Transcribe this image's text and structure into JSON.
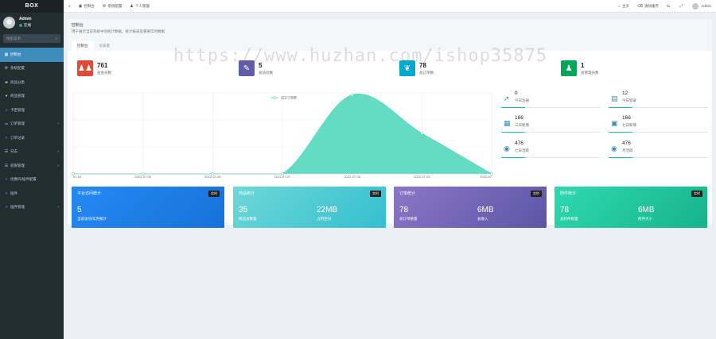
{
  "sidebar": {
    "brand": "BOX",
    "user_name": "Admin",
    "user_status": "在线",
    "search_placeholder": "搜索菜单",
    "items": [
      {
        "icon": "▦",
        "label": "控制台",
        "active": true
      },
      {
        "icon": "⚙",
        "label": "系统配置"
      },
      {
        "icon": "▰",
        "label": "商品分类"
      },
      {
        "icon": "♦",
        "label": "商品管理"
      },
      {
        "icon": "○",
        "label": "卡密管理"
      },
      {
        "icon": "⚏",
        "label": "订单管理",
        "arrow": "‹"
      },
      {
        "icon": "○",
        "label": "订单记录"
      },
      {
        "icon": "☰",
        "label": "日志",
        "arrow": "‹"
      },
      {
        "icon": "☰",
        "label": "权限管理",
        "arrow": "‹"
      },
      {
        "icon": "○",
        "label": "优惠码/插件配置"
      },
      {
        "icon": "○",
        "label": "插件"
      },
      {
        "icon": "○",
        "label": "插件管理",
        "arrow": "‹"
      }
    ]
  },
  "topbar": {
    "menu_icon": "≡",
    "items": [
      {
        "icon": "▣",
        "label": "控制台"
      },
      {
        "icon": "⚙",
        "label": "系统配置"
      },
      {
        "icon": "♟",
        "label": "个人管理"
      }
    ],
    "right": [
      {
        "icon": "⌂",
        "label": "主页"
      },
      {
        "icon": "⌫",
        "label": "清除缓存"
      },
      {
        "icon": "⇆",
        "label": ""
      },
      {
        "icon": "⤢",
        "label": ""
      }
    ],
    "user": "Admin"
  },
  "header": {
    "title": "控制台",
    "desc": "用于展示当前系统中的统计数据、统计报表及重要实时数据"
  },
  "tabs": [
    "控制台",
    "仪表盘"
  ],
  "stats": [
    {
      "num": "761",
      "label": "总会员数",
      "icon": "♟♟",
      "color": "#dd4b39"
    },
    {
      "num": "5",
      "label": "总访问数",
      "icon": "✎",
      "color": "#605ca8"
    },
    {
      "num": "78",
      "label": "总订单数",
      "icon": "❦",
      "color": "#00a7d0"
    },
    {
      "num": "1",
      "label": "总管理员数",
      "icon": "♟",
      "color": "#00a65a"
    }
  ],
  "chart_data": {
    "type": "area",
    "legend": "成交订单数",
    "x": [
      "07-04",
      "2022-07-05",
      "2022-07-06",
      "2022-07-07",
      "2022-07-08",
      "2022-07-09",
      "2022-07"
    ],
    "values": [
      0,
      0,
      0,
      0,
      78,
      40,
      0
    ],
    "color": "#5cd9c0"
  },
  "right_stats": [
    {
      "icon": "➚",
      "num": "0",
      "label": "今日注册"
    },
    {
      "icon": "▤",
      "num": "12",
      "label": "今日登录"
    },
    {
      "icon": "▦",
      "num": "166",
      "label": "三日新增"
    },
    {
      "icon": "▣",
      "num": "166",
      "label": "七日新增"
    },
    {
      "icon": "◉",
      "num": "476",
      "label": "七日活跃"
    },
    {
      "icon": "◉",
      "num": "476",
      "label": "月活跃"
    }
  ],
  "cards": [
    {
      "title": "平台访问统计",
      "badge": "实时",
      "val1": "5",
      "sub1": "当前访问/实时统计",
      "val2": "",
      "sub2": "",
      "grad": "linear-gradient(135deg,#2589f5,#1772d8)"
    },
    {
      "title": "商品统计",
      "badge": "实时",
      "val1": "35",
      "sub1": "商品总数量",
      "val2": "22MB",
      "sub2": "占用空间",
      "grad": "linear-gradient(135deg,#6ed8d8,#34bfcf)"
    },
    {
      "title": "订单统计",
      "badge": "实时",
      "val1": "78",
      "sub1": "总订单数量",
      "val2": "6MB",
      "sub2": "总收入",
      "grad": "linear-gradient(135deg,#8b76c7,#5d55a6)"
    },
    {
      "title": "附件统计",
      "badge": "实时",
      "val1": "78",
      "sub1": "总附件数量",
      "val2": "6MB",
      "sub2": "附件大小",
      "grad": "linear-gradient(135deg,#2fd9b0,#17b38a)"
    }
  ],
  "watermark": "https://www.huzhan.com/ishop35875"
}
